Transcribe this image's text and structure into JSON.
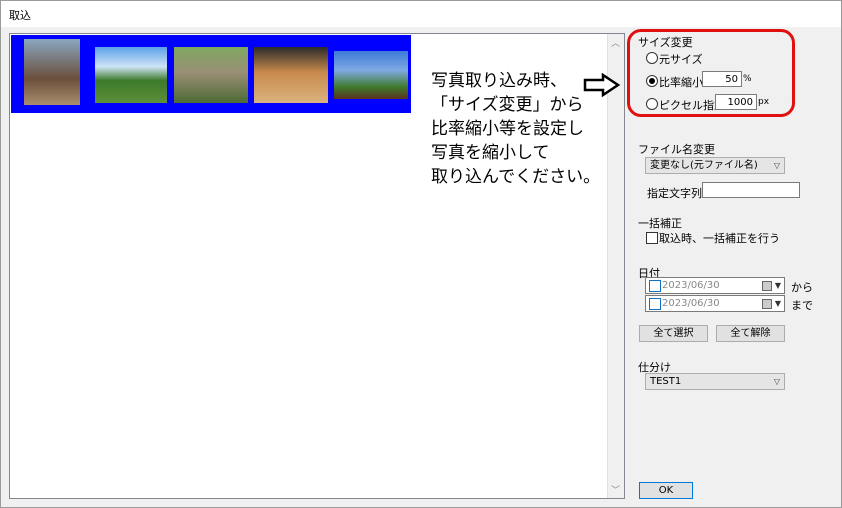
{
  "window": {
    "title": "取込"
  },
  "instructions": {
    "line1": "写真取り込み時、",
    "line2": "「サイズ変更」から",
    "line3": "比率縮小等を設定し",
    "line4": "写真を縮小して",
    "line5": "取り込んでください。"
  },
  "size_change": {
    "header": "サイズ変更",
    "original_label": "元サイズ",
    "ratio_label": "比率縮小",
    "ratio_value": "50",
    "ratio_unit": "%",
    "pixel_label": "ピクセル指定",
    "pixel_value": "1000",
    "pixel_unit": "px",
    "selected": "ratio"
  },
  "filename": {
    "header": "ファイル名変更",
    "select_value": "変更なし(元ファイル名)",
    "text_label": "指定文字列",
    "text_value": ""
  },
  "batch": {
    "header": "一括補正",
    "checkbox_label": "取込時、一括補正を行う"
  },
  "date": {
    "header": "日付",
    "from_value": "2023/06/30",
    "from_suffix": "から",
    "to_value": "2023/06/30",
    "to_suffix": "まで"
  },
  "buttons": {
    "select_all": "全て選択",
    "deselect_all": "全て解除",
    "ok": "OK"
  },
  "sort": {
    "header": "仕分け",
    "select_value": "TEST1"
  },
  "colors": {
    "thumb_strip_bg": "#0000ff",
    "annotation_red": "#e01010"
  }
}
